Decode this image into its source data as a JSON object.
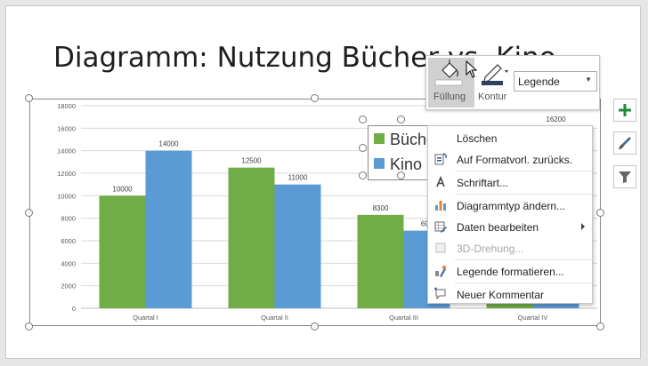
{
  "slide": {
    "title": "Diagramm: Nutzung Bücher vs. Kino"
  },
  "chart_data": {
    "type": "bar",
    "categories": [
      "Quartal I",
      "Quartal II",
      "Quartal III",
      "Quartal IV"
    ],
    "series": [
      {
        "name": "Bücher",
        "color": "#70ad47",
        "values": [
          10000,
          12500,
          8300,
          2000
        ]
      },
      {
        "name": "Kino",
        "color": "#5b9bd5",
        "values": [
          14000,
          11000,
          6900,
          16200
        ]
      }
    ],
    "data_labels": [
      [
        "10000",
        "12500",
        "8300",
        ""
      ],
      [
        "14000",
        "11000",
        "690",
        "16200"
      ]
    ],
    "y_ticks": [
      "0",
      "2000",
      "4000",
      "6000",
      "8000",
      "10000",
      "12000",
      "14000",
      "16000",
      "18000"
    ],
    "ylim": [
      0,
      18000
    ],
    "legend": {
      "placement": "top-right",
      "items": [
        "Büche",
        "Kino"
      ]
    }
  },
  "toolbar": {
    "fill_label": "Füllung",
    "outline_label": "Kontur",
    "element_select": "Legende",
    "fill_icon": "paint-bucket-icon",
    "outline_icon": "pen-icon"
  },
  "side_buttons": {
    "add_icon": "plus-icon",
    "style_icon": "brush-icon",
    "filter_icon": "filter-icon"
  },
  "context_menu": {
    "items": [
      {
        "label": "Löschen",
        "icon": "",
        "disabled": false
      },
      {
        "label": "Auf Formatvorl. zurücks.",
        "icon": "reset-format-icon",
        "disabled": false
      },
      {
        "label": "Schriftart...",
        "icon": "font-icon",
        "disabled": false
      },
      {
        "label": "Diagrammtyp ändern...",
        "icon": "chart-type-icon",
        "disabled": false
      },
      {
        "label": "Daten bearbeiten",
        "icon": "edit-data-icon",
        "disabled": false
      },
      {
        "label": "3D-Drehung...",
        "icon": "rotate-3d-icon",
        "disabled": true
      },
      {
        "label": "Legende formatieren...",
        "icon": "format-legend-icon",
        "disabled": false
      },
      {
        "label": "Neuer Kommentar",
        "icon": "comment-icon",
        "disabled": false
      }
    ]
  }
}
